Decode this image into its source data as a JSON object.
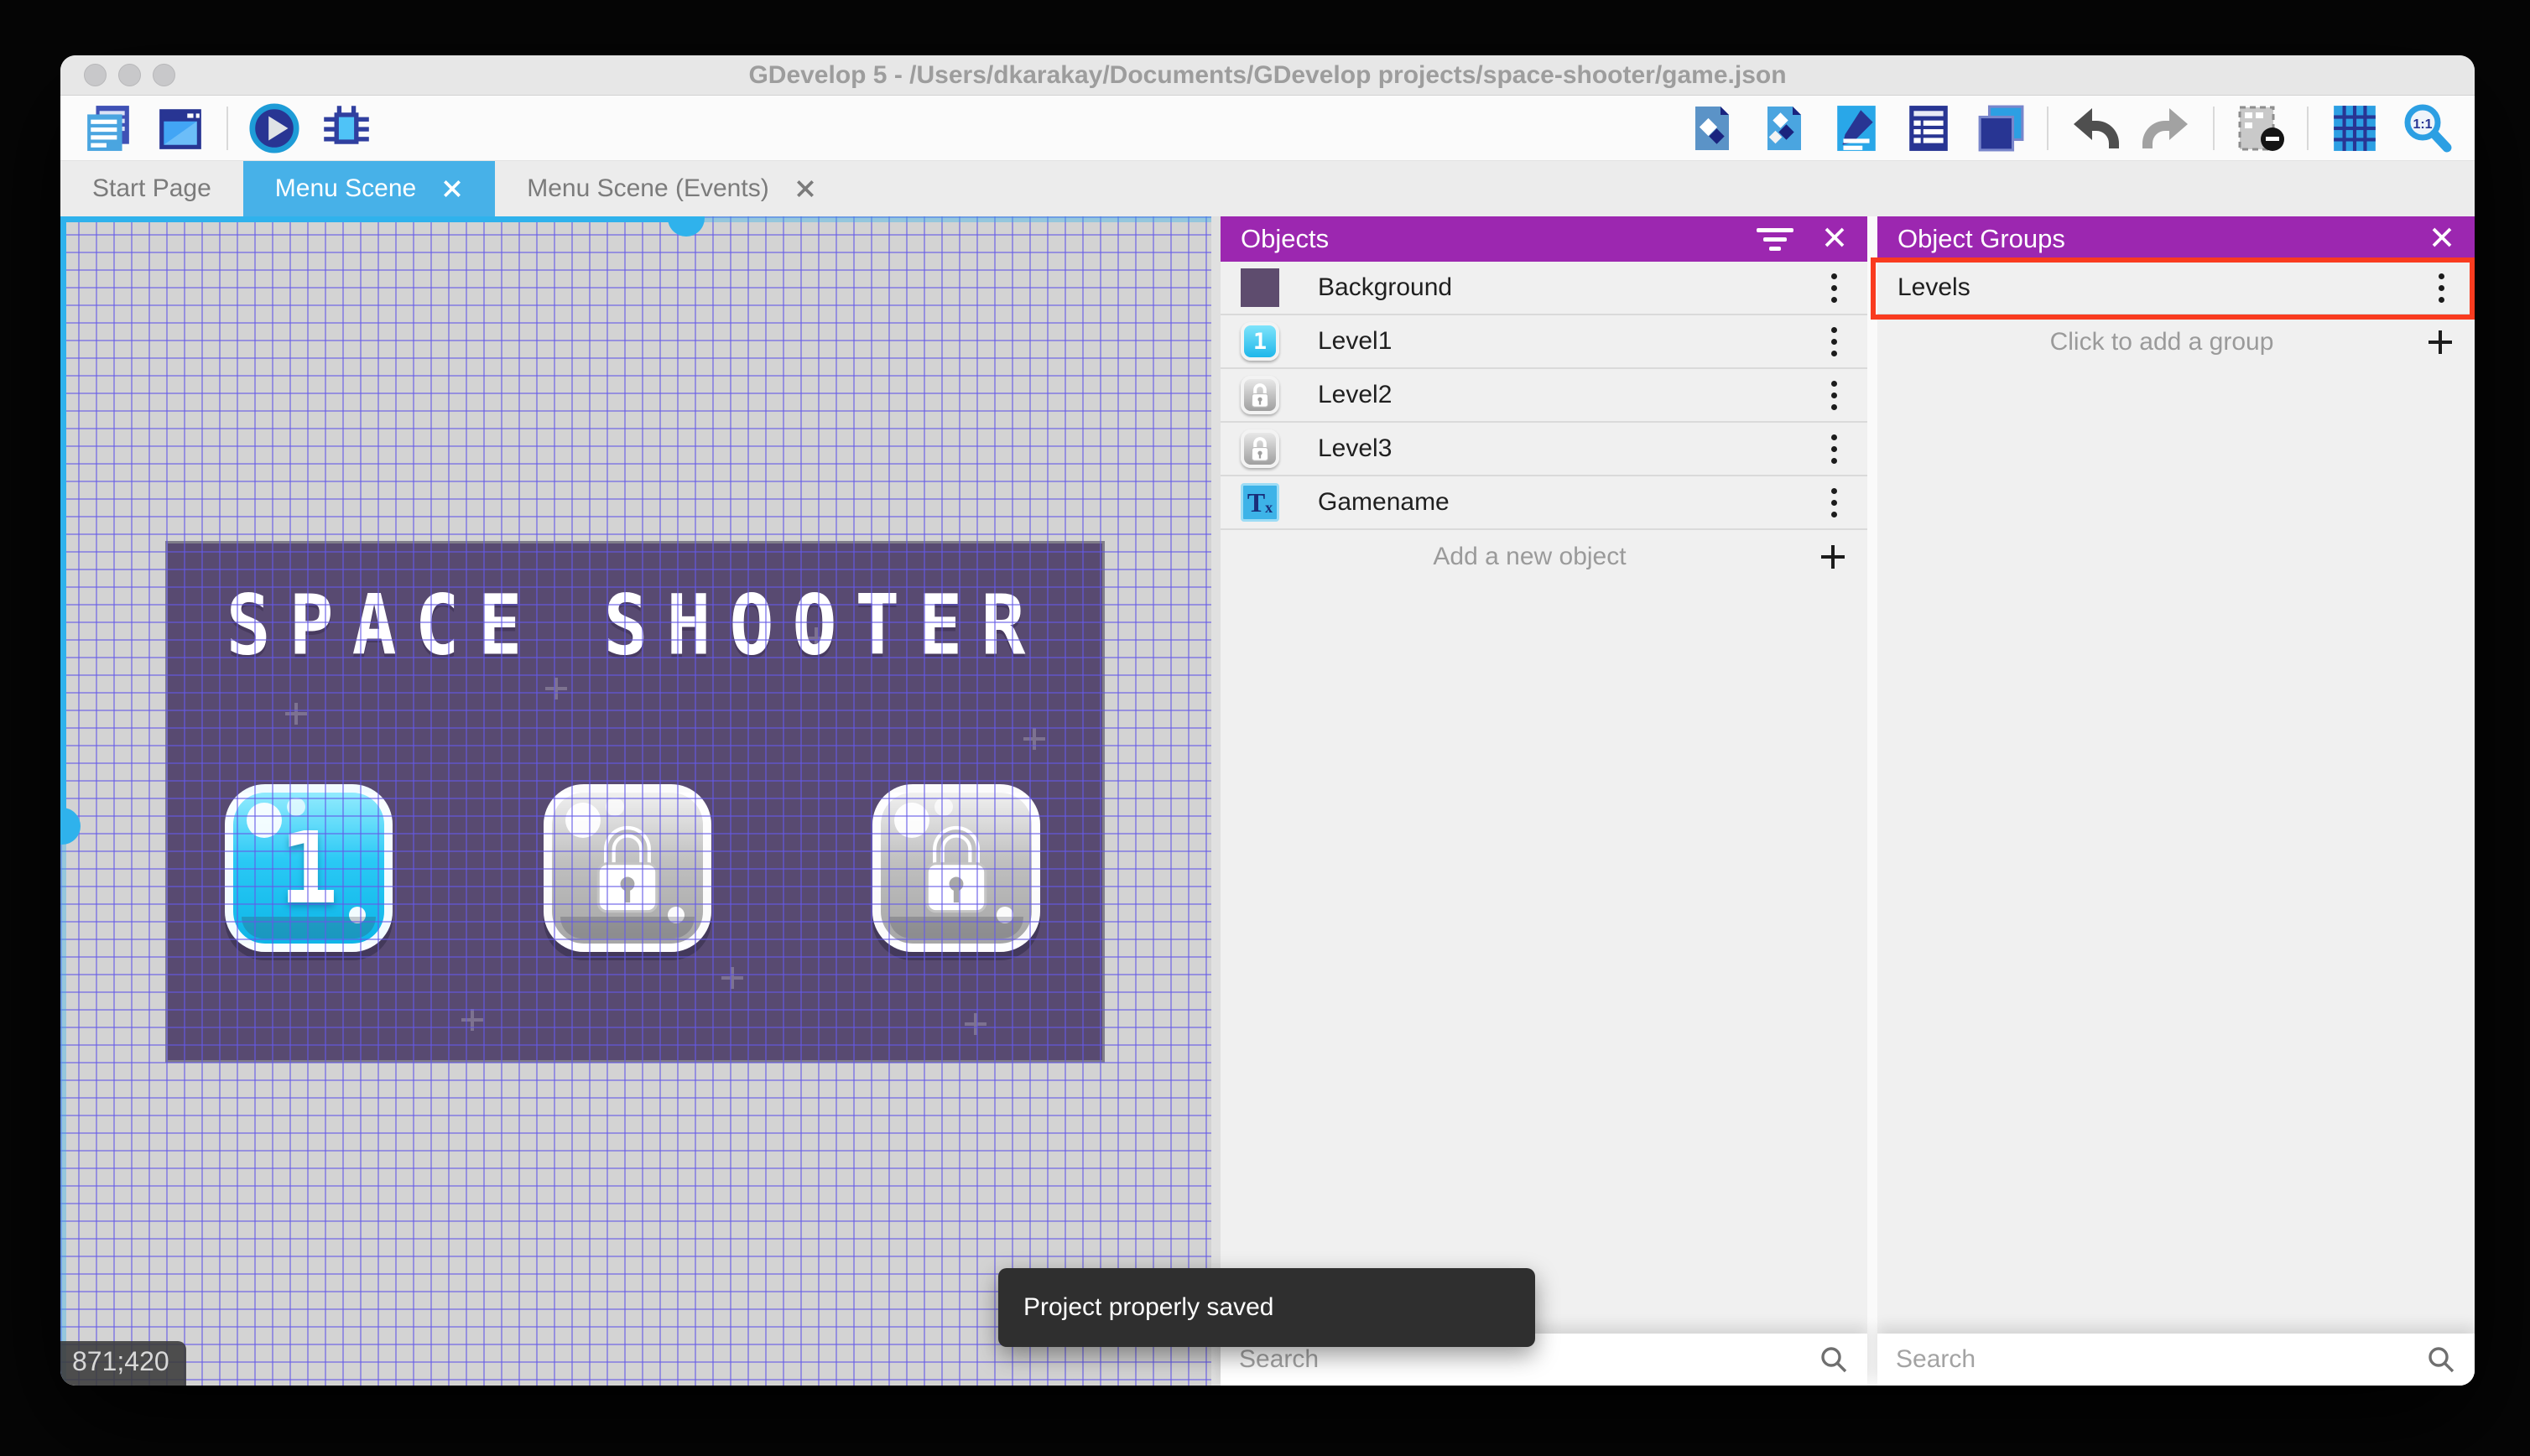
{
  "window": {
    "title": "GDevelop 5 - /Users/dkarakay/Documents/GDevelop projects/space-shooter/game.json"
  },
  "toolbar": {
    "left_icons": [
      "project-manager-icon",
      "scene-editor-icon",
      "play-icon",
      "debug-icon"
    ],
    "right_icons": [
      "objects-panel-icon",
      "object-groups-panel-icon",
      "properties-panel-icon",
      "instances-list-icon",
      "layers-panel-icon",
      "undo-icon",
      "redo-icon",
      "instances-mask-icon",
      "grid-icon",
      "zoom-original-icon"
    ],
    "zoom_label": "1:1"
  },
  "tabs": [
    {
      "label": "Start Page",
      "active": false,
      "closable": false
    },
    {
      "label": "Menu Scene",
      "active": true,
      "closable": true
    },
    {
      "label": "Menu Scene (Events)",
      "active": false,
      "closable": true
    }
  ],
  "canvas": {
    "coordinates": "871;420",
    "scene": {
      "title": "SPACE SHOOTER",
      "level_buttons": [
        {
          "label": "1",
          "locked": false
        },
        {
          "label": "",
          "locked": true
        },
        {
          "label": "",
          "locked": true
        }
      ]
    }
  },
  "objects_panel": {
    "title": "Objects",
    "items": [
      {
        "name": "Background",
        "thumb": "purple-square"
      },
      {
        "name": "Level1",
        "thumb": "level1-button"
      },
      {
        "name": "Level2",
        "thumb": "locked-button"
      },
      {
        "name": "Level3",
        "thumb": "locked-button"
      },
      {
        "name": "Gamename",
        "thumb": "text-object",
        "thumb_glyph_main": "T",
        "thumb_glyph_sub": "x"
      }
    ],
    "add_label": "Add a new object",
    "search_placeholder": "Search"
  },
  "groups_panel": {
    "title": "Object Groups",
    "items": [
      {
        "name": "Levels",
        "highlighted": true
      }
    ],
    "add_label": "Click to add a group",
    "search_placeholder": "Search"
  },
  "toast": {
    "message": "Project properly saved"
  },
  "colors": {
    "accent_blue": "#47b1e8",
    "panel_purple": "#9c27b0",
    "annotation_red": "#f93b1f",
    "scene_background": "#584a71",
    "grid_line": "#6b5fe8",
    "scrollbar_cyan": "#2fb2ec"
  }
}
